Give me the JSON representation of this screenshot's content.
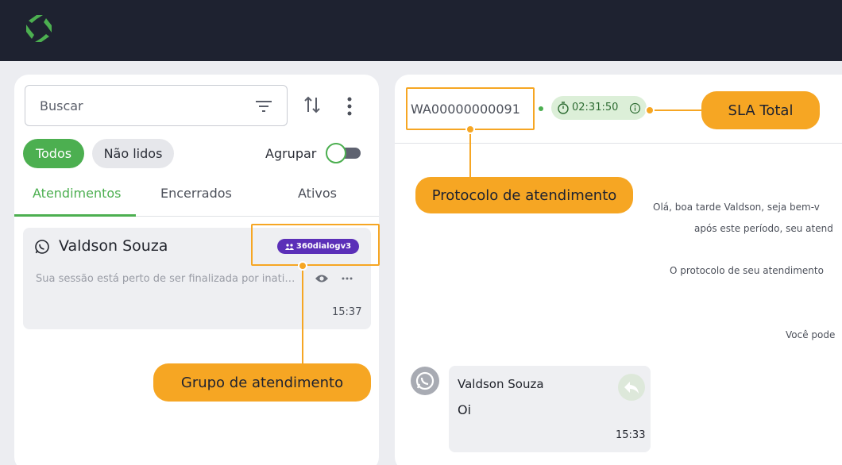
{
  "topbar": {
    "logo_icon": "app-logo-refresh"
  },
  "sidebar": {
    "search": {
      "placeholder": "Buscar"
    },
    "chips": {
      "all": "Todos",
      "unread": "Não lidos"
    },
    "group_toggle": {
      "label": "Agrupar",
      "on": false
    },
    "tabs": [
      {
        "label": "Atendimentos",
        "active": true
      },
      {
        "label": "Encerrados",
        "active": false
      },
      {
        "label": "Ativos",
        "active": false
      }
    ],
    "conversations": [
      {
        "name": "Valdson Souza",
        "badge": "360dialogv3",
        "preview": "Sua sessão está perto de ser finalizada por inatividade",
        "time": "15:37"
      }
    ]
  },
  "chat": {
    "protocol": "WA00000000091",
    "sla_time": "02:31:50",
    "system_messages": [
      "Olá, boa tarde Valdson, seja bem-v",
      "após este período, seu atend",
      "O protocolo de seu atendimento",
      "Você pode"
    ],
    "message": {
      "sender": "Valdson Souza",
      "text": "Oi",
      "time": "15:33"
    }
  },
  "annotations": {
    "sla_total": "SLA Total",
    "protocolo": "Protocolo de atendimento",
    "grupo": "Grupo de atendimento"
  },
  "colors": {
    "accent_green": "#4CAF50",
    "callout_orange": "#F6A623",
    "badge_purple": "#5B2FB8",
    "topbar": "#1E2230"
  }
}
